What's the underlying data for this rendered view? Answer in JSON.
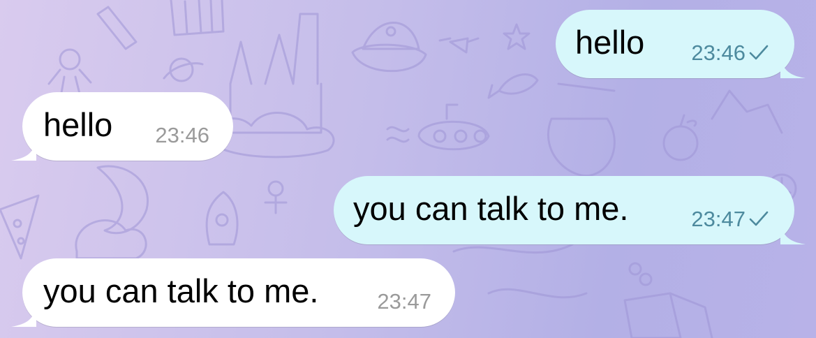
{
  "colors": {
    "outgoing_bubble": "#d7f7fb",
    "incoming_bubble": "#ffffff",
    "outgoing_meta": "#4d8a9e",
    "incoming_meta": "#9a9a9a",
    "background": "#c4bdea"
  },
  "messages": [
    {
      "direction": "outgoing",
      "text": "hello",
      "time": "23:46",
      "status_icon": "check-icon"
    },
    {
      "direction": "incoming",
      "text": "hello",
      "time": "23:46"
    },
    {
      "direction": "outgoing",
      "text": "you can talk to me.",
      "time": "23:47",
      "status_icon": "check-icon"
    },
    {
      "direction": "incoming",
      "text": "you can talk to me.",
      "time": "23:47"
    }
  ]
}
